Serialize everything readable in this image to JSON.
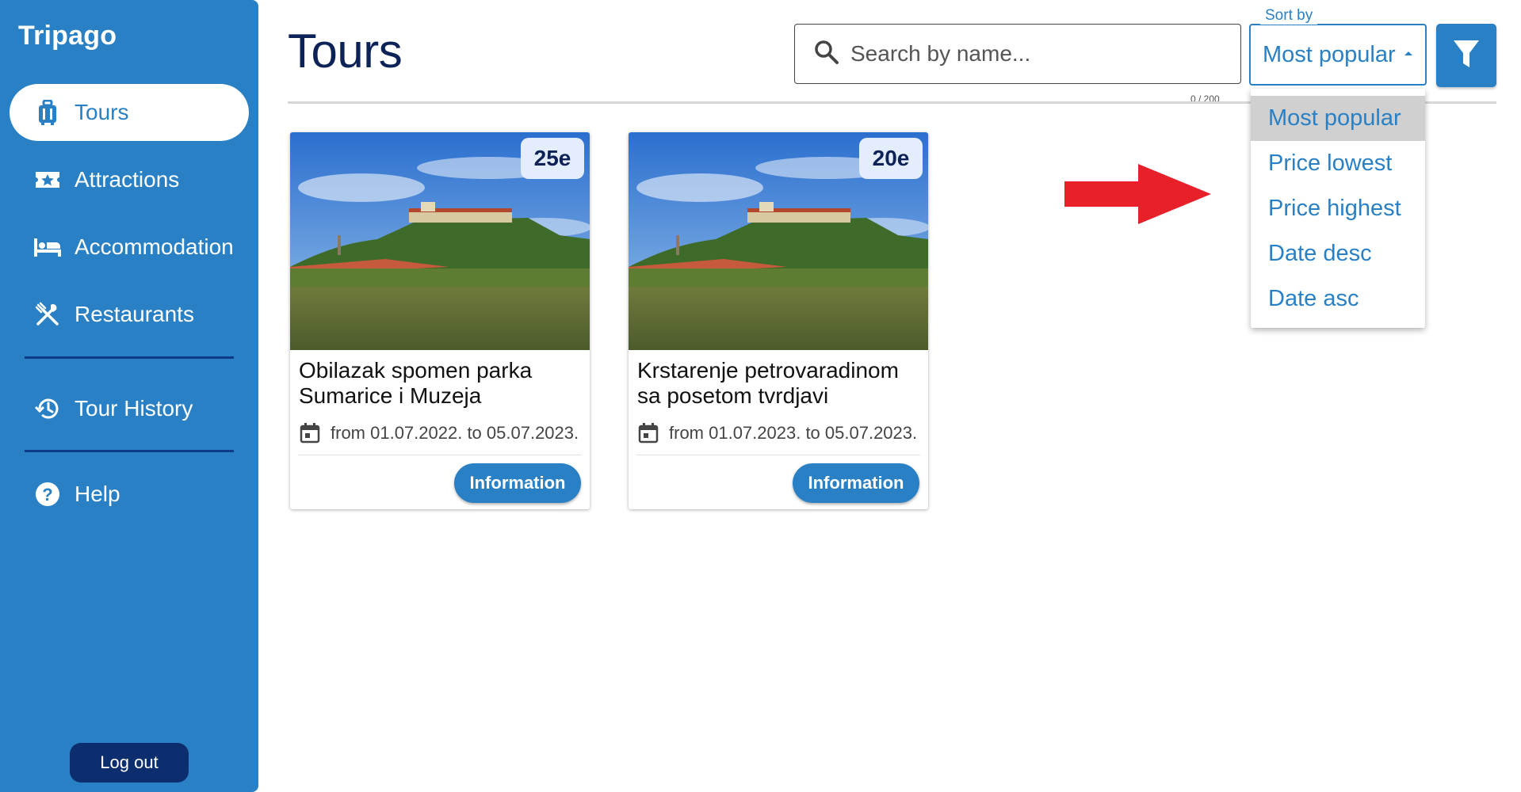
{
  "app": {
    "brand": "Tripago"
  },
  "sidebar": {
    "items": [
      {
        "label": "Tours",
        "icon": "luggage-icon",
        "active": true
      },
      {
        "label": "Attractions",
        "icon": "ticket-star-icon",
        "active": false
      },
      {
        "label": "Accommodation",
        "icon": "bed-icon",
        "active": false
      },
      {
        "label": "Restaurants",
        "icon": "fork-knife-icon",
        "active": false
      },
      {
        "label": "Tour History",
        "icon": "history-icon",
        "active": false
      },
      {
        "label": "Help",
        "icon": "help-circle-icon",
        "active": false
      }
    ],
    "logout_label": "Log out"
  },
  "header": {
    "title": "Tours",
    "search": {
      "placeholder": "Search by name...",
      "value": "",
      "char_count": "0 / 200"
    },
    "sort": {
      "label": "Sort by",
      "selected": "Most popular",
      "options": [
        "Most popular",
        "Price lowest",
        "Price highest",
        "Date desc",
        "Date asc"
      ]
    }
  },
  "tours": [
    {
      "title": "Obilazak spomen parka Sumarice i Muzeja",
      "price": "25e",
      "dates": "from 01.07.2022. to 05.07.2023.",
      "button": "Information"
    },
    {
      "title": "Krstarenje petrovaradinom sa posetom tvrdjavi",
      "price": "20e",
      "dates": "from 01.07.2023. to 05.07.2023.",
      "button": "Information"
    }
  ],
  "colors": {
    "primary": "#2980c4",
    "navy": "#0d2257",
    "logout_bg": "#0d2e6e",
    "badge_bg": "#e3edfb",
    "annotation_arrow": "#e8202a"
  }
}
